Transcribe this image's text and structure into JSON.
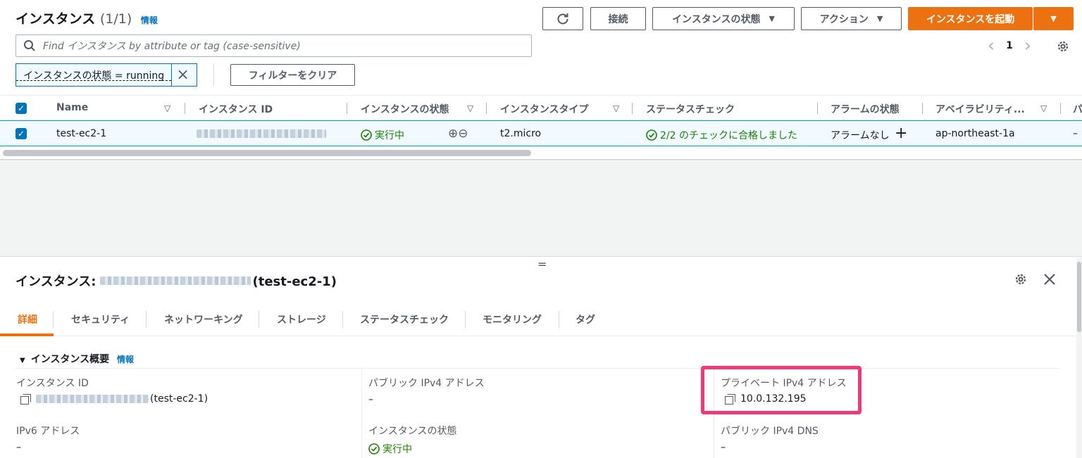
{
  "header": {
    "title": "インスタンス",
    "count": "(1/1)",
    "info": "情報"
  },
  "toolbar": {
    "refresh_icon": "refresh-icon",
    "connect_label": "接続",
    "state_label": "インスタンスの状態",
    "actions_label": "アクション",
    "launch_label": "インスタンスを起動"
  },
  "search": {
    "placeholder": "Find インスタンス by attribute or tag (case-sensitive)",
    "icon": "search-icon"
  },
  "pagination": {
    "page": "1",
    "prev": "‹",
    "next": "›"
  },
  "filter": {
    "token": "インスタンスの状態 = running",
    "clear_label": "フィルターをクリア"
  },
  "table": {
    "columns": [
      "Name",
      "インスタンス ID",
      "インスタンスの状態",
      "インスタンスタイプ",
      "ステータスチェック",
      "アラームの状態",
      "アベイラビリティ...",
      "パ"
    ],
    "row": {
      "name": "test-ec2-1",
      "state": "実行中",
      "type": "t2.micro",
      "status_check": "2/2 のチェックに合格しました",
      "alarm": "アラームなし",
      "az": "ap-northeast-1a",
      "last": "–"
    }
  },
  "details": {
    "title_prefix": "インスタンス:",
    "title_suffix": "(test-ec2-1)",
    "tabs": [
      "詳細",
      "セキュリティ",
      "ネットワーキング",
      "ストレージ",
      "ステータスチェック",
      "モニタリング",
      "タグ"
    ],
    "section": "インスタンス概要",
    "section_info": "情報",
    "fields": {
      "instance_id_label": "インスタンス ID",
      "instance_id_suffix": "(test-ec2-1)",
      "public_ipv4_label": "パブリック IPv4 アドレス",
      "public_ipv4_value": "–",
      "private_ipv4_label": "プライベート IPv4 アドレス",
      "private_ipv4_value": "10.0.132.195",
      "ipv6_label": "IPv6 アドレス",
      "ipv6_value": "–",
      "state_label": "インスタンスの状態",
      "state_value": "実行中",
      "public_dns_label": "パブリック IPv4 DNS",
      "public_dns_value": "–"
    }
  },
  "colors": {
    "accent": "#ec7211",
    "link": "#0073bb",
    "success": "#1d8102",
    "highlight": "#f0387a"
  }
}
